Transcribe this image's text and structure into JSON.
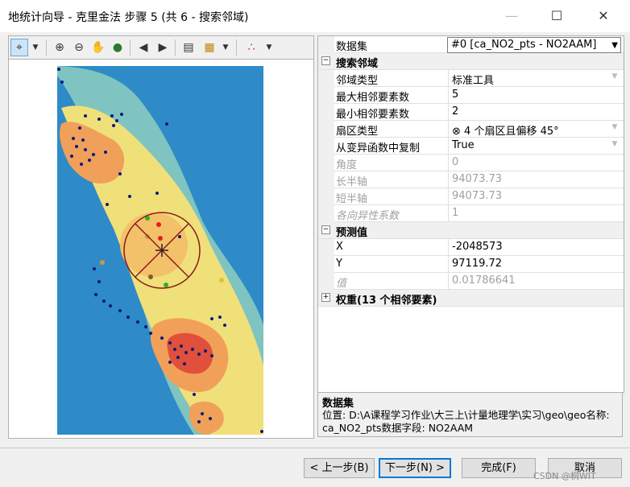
{
  "window": {
    "title": "地统计向导 - 克里金法 步骤 5 (共 6 - 搜索邻域)",
    "minimize_icon": "minimize-icon",
    "maximize_icon": "maximize-icon",
    "close_icon": "close-icon"
  },
  "toolbar": {
    "icons": [
      "crosshair-icon",
      "zoom-in-icon",
      "zoom-out-icon",
      "pan-hand-icon",
      "globe-icon",
      "back-arrow-icon",
      "forward-arrow-icon",
      "table-icon",
      "layer-icon",
      "points-icon"
    ]
  },
  "properties": {
    "dataset_label": "数据集",
    "dataset_value": "#0 [ca_NO2_pts - NO2AAM]",
    "section_search": "搜索邻域",
    "neighborhood_type_label": "邻域类型",
    "neighborhood_type_value": "标准工具",
    "max_neighbors_label": "最大相邻要素数",
    "max_neighbors_value": "5",
    "min_neighbors_label": "最小相邻要素数",
    "min_neighbors_value": "2",
    "sector_type_label": "扇区类型",
    "sector_type_value": "4 个扇区且偏移 45°",
    "copy_from_variogram_label": "从变异函数中复制",
    "copy_from_variogram_value": "True",
    "angle_label": "角度",
    "angle_value": "0",
    "major_axis_label": "长半轴",
    "major_axis_value": "94073.73",
    "minor_axis_label": "短半轴",
    "minor_axis_value": "94073.73",
    "anisotropy_label": "各向异性系数",
    "anisotropy_value": "1",
    "section_predicted": "预测值",
    "x_label": "X",
    "x_value": "-2048573",
    "y_label": "Y",
    "y_value": "97119.72",
    "value_label": "值",
    "value_value": "0.01786641",
    "section_weights": "权重(13 个相邻要素)"
  },
  "description": {
    "heading": "数据集",
    "text": "位置: D:\\A课程学习作业\\大三上\\计量地理学\\实习\\geo\\geo名称: ca_NO2_pts数据字段: NO2AAM"
  },
  "buttons": {
    "back": "< 上一步(B)",
    "next": "下一步(N) >",
    "finish": "完成(F)",
    "cancel": "取消"
  },
  "watermark": "CSDN @桐WIT",
  "colors": {
    "sea": "#2e8bc7",
    "low": "#7fc4c0",
    "mid": "#f0e07a",
    "high": "#f1a05a",
    "peak": "#e0503a",
    "point": "#0a1a7a",
    "search_circle": "#8b1a1a"
  }
}
